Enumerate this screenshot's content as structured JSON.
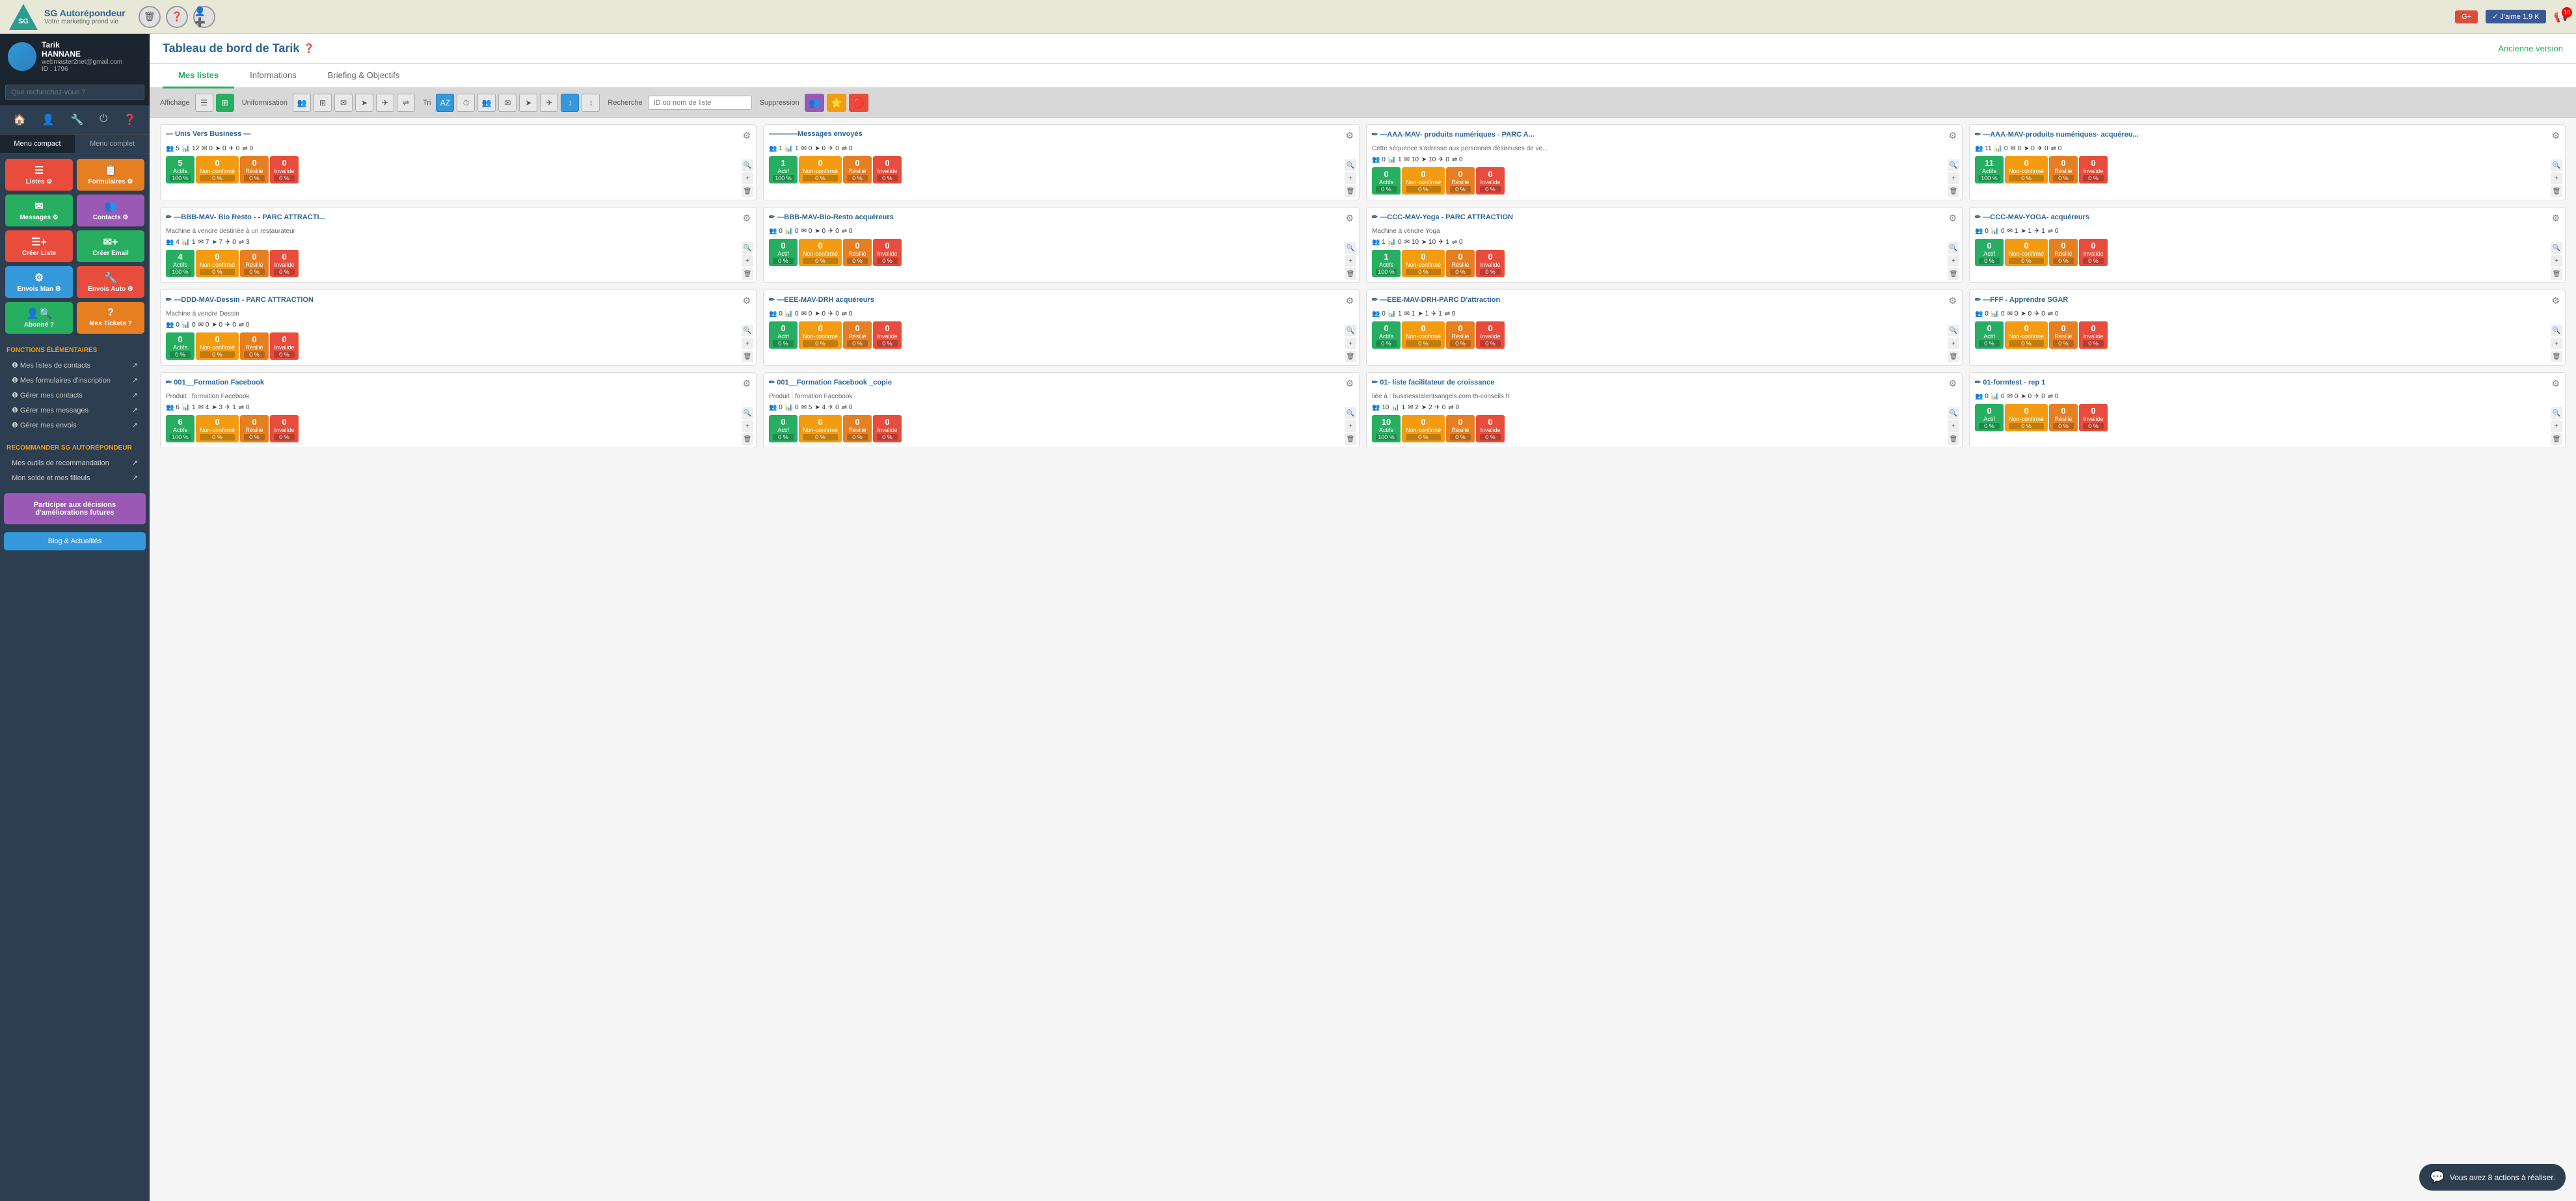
{
  "app": {
    "name": "SG Autorépondeur",
    "tagline": "Votre marketing prend vie",
    "gplus": "G+",
    "jaime": "✓ J'aime 1.9 K",
    "notif_count": "10"
  },
  "header_icons": {
    "delete": "🗑",
    "help": "❓",
    "user_circle": "👤",
    "add_user": "➕"
  },
  "user": {
    "name": "Tarik",
    "lastname": "HANNANE",
    "email": "webmaster2net@gmail.com",
    "id": "ID : 1796"
  },
  "search": {
    "placeholder": "Que recherchez-vous ?"
  },
  "menu": {
    "compact": "Menu compact",
    "complet": "Menu complet"
  },
  "quick_actions": [
    {
      "label": "Listes",
      "icon": "☰",
      "color": "#e74c3c"
    },
    {
      "label": "Formulaires",
      "icon": "📋",
      "color": "#e67e22"
    },
    {
      "label": "Messages",
      "icon": "✉",
      "color": "#27ae60"
    },
    {
      "label": "Contacts",
      "icon": "👥",
      "color": "#9b59b6"
    },
    {
      "label": "Créer Liste",
      "icon": "☰+",
      "color": "#e74c3c"
    },
    {
      "label": "Créer Email",
      "icon": "✉+",
      "color": "#27ae60"
    },
    {
      "label": "Envois Man",
      "icon": "⚙",
      "color": "#3498db"
    },
    {
      "label": "Envois Auto",
      "icon": "🔧",
      "color": "#e74c3c"
    },
    {
      "label": "Abonné ?",
      "icon": "🔍",
      "color": "#27ae60"
    },
    {
      "label": "Mes Tickets",
      "icon": "?",
      "color": "#e67e22"
    }
  ],
  "fonctions_elementaires": {
    "title": "FONCTIONS ÉLÉMENTAIRES",
    "items": [
      "Mes listes de contacts",
      "Mes formulaires d'inscription",
      "Gérer mes contacts",
      "Gérer mes messages",
      "Gérer mes envois"
    ]
  },
  "recommander": {
    "title": "RECOMMANDER SG AUTORÉPONDEUR",
    "items": [
      "Mes outils de recommandation",
      "Mon solde et mes filleuls"
    ]
  },
  "promo": "Participer aux décisions d'améliorations futures",
  "blog": "Blog & Actualités",
  "page": {
    "title": "Tableau de bord de Tarik",
    "old_version": "Ancienne version",
    "tabs": [
      {
        "id": "mes-listes",
        "label": "Mes listes",
        "active": true
      },
      {
        "id": "informations",
        "label": "Informations",
        "active": false
      },
      {
        "id": "briefing",
        "label": "Briefing & Objectifs",
        "active": false
      }
    ]
  },
  "toolbar": {
    "affichage": "Affichage",
    "uniformisation": "Uniformisation",
    "tri": "Tri",
    "recherche": "Recherche",
    "suppression": "Suppression",
    "search_placeholder": "ID ou nom de liste"
  },
  "lists": [
    {
      "title": "— Unis Vers Business —",
      "subtitle": "",
      "stats": [
        5,
        12,
        0,
        0,
        0,
        0
      ],
      "badges": [
        {
          "num": "5",
          "label": "Actifs",
          "pct": "100 %",
          "color": "badge-green"
        },
        {
          "num": "0",
          "label": "Non-confirmé",
          "pct": "0 %",
          "color": "badge-yellow"
        },
        {
          "num": "0",
          "label": "Résilié",
          "pct": "0 %",
          "color": "badge-orange"
        },
        {
          "num": "0",
          "label": "Invalide",
          "pct": "0 %",
          "color": "badge-red"
        }
      ]
    },
    {
      "title": "————Messages envoyés",
      "subtitle": "",
      "stats": [
        1,
        1,
        0,
        0,
        0,
        0
      ],
      "badges": [
        {
          "num": "1",
          "label": "Actif",
          "pct": "100 %",
          "color": "badge-green"
        },
        {
          "num": "0",
          "label": "Non-confirmé",
          "pct": "0 %",
          "color": "badge-yellow"
        },
        {
          "num": "0",
          "label": "Résilié",
          "pct": "0 %",
          "color": "badge-orange"
        },
        {
          "num": "0",
          "label": "Invalide",
          "pct": "0 %",
          "color": "badge-red"
        }
      ]
    },
    {
      "title": "✏ —AAA-MAV- produits numériques - PARC A...",
      "subtitle": "Cette séquence s'adresse aux personnes désireuses de ve...",
      "stats": [
        0,
        1,
        10,
        10,
        0,
        0
      ],
      "badges": [
        {
          "num": "0",
          "label": "Actifs",
          "pct": "0 %",
          "color": "badge-green"
        },
        {
          "num": "0",
          "label": "Non-confirmé",
          "pct": "0 %",
          "color": "badge-yellow"
        },
        {
          "num": "0",
          "label": "Résilié",
          "pct": "0 %",
          "color": "badge-orange"
        },
        {
          "num": "0",
          "label": "Invalide",
          "pct": "0 %",
          "color": "badge-red"
        }
      ]
    },
    {
      "title": "✏ —AAA-MAV-produits numériques- acquéreu...",
      "subtitle": "",
      "stats": [
        11,
        0,
        0,
        0,
        0,
        0
      ],
      "badges": [
        {
          "num": "11",
          "label": "Actifs",
          "pct": "100 %",
          "color": "badge-green"
        },
        {
          "num": "0",
          "label": "Non-confirmé",
          "pct": "0 %",
          "color": "badge-yellow"
        },
        {
          "num": "0",
          "label": "Résilié",
          "pct": "0 %",
          "color": "badge-orange"
        },
        {
          "num": "0",
          "label": "Invalide",
          "pct": "0 %",
          "color": "badge-red"
        }
      ]
    },
    {
      "title": "✏ —BBB-MAV- Bio Resto - - PARC ATTRACTI...",
      "subtitle": "Machine à vendre destinée à un restaurateur",
      "stats": [
        4,
        1,
        7,
        7,
        0,
        3
      ],
      "badges": [
        {
          "num": "4",
          "label": "Actifs",
          "pct": "100 %",
          "color": "badge-green"
        },
        {
          "num": "0",
          "label": "Non-confirmé",
          "pct": "0 %",
          "color": "badge-yellow"
        },
        {
          "num": "0",
          "label": "Résilié",
          "pct": "0 %",
          "color": "badge-orange"
        },
        {
          "num": "0",
          "label": "Invalide",
          "pct": "0 %",
          "color": "badge-red"
        }
      ]
    },
    {
      "title": "✏ —BBB-MAV-Bio-Resto acquéreurs",
      "subtitle": "",
      "stats": [
        0,
        0,
        0,
        0,
        0,
        0
      ],
      "badges": [
        {
          "num": "0",
          "label": "Actif",
          "pct": "0 %",
          "color": "badge-green"
        },
        {
          "num": "0",
          "label": "Non-confirmé",
          "pct": "0 %",
          "color": "badge-yellow"
        },
        {
          "num": "0",
          "label": "Résilié",
          "pct": "0 %",
          "color": "badge-orange"
        },
        {
          "num": "0",
          "label": "Invalide",
          "pct": "0 %",
          "color": "badge-red"
        }
      ]
    },
    {
      "title": "✏ —CCC-MAV-Yoga - PARC ATTRACTION",
      "subtitle": "Machine à vendre Yoga",
      "stats": [
        1,
        0,
        10,
        10,
        1,
        0
      ],
      "badges": [
        {
          "num": "1",
          "label": "Actifs",
          "pct": "100 %",
          "color": "badge-green"
        },
        {
          "num": "0",
          "label": "Non-confirmé",
          "pct": "0 %",
          "color": "badge-yellow"
        },
        {
          "num": "0",
          "label": "Résilié",
          "pct": "0 %",
          "color": "badge-orange"
        },
        {
          "num": "0",
          "label": "Invalide",
          "pct": "0 %",
          "color": "badge-red"
        }
      ]
    },
    {
      "title": "✏ —CCC-MAV-YOGA- acquéreurs",
      "subtitle": "",
      "stats": [
        0,
        0,
        1,
        1,
        1,
        0
      ],
      "badges": [
        {
          "num": "0",
          "label": "Actif",
          "pct": "0 %",
          "color": "badge-green"
        },
        {
          "num": "0",
          "label": "Non-confirmé",
          "pct": "0 %",
          "color": "badge-yellow"
        },
        {
          "num": "0",
          "label": "Résilié",
          "pct": "0 %",
          "color": "badge-orange"
        },
        {
          "num": "0",
          "label": "Invalide",
          "pct": "0 %",
          "color": "badge-red"
        }
      ]
    },
    {
      "title": "✏ —DDD-MAV-Dessin - PARC ATTRACTION",
      "subtitle": "Machine à vendre Dessin",
      "stats": [
        0,
        0,
        0,
        0,
        0,
        0
      ],
      "badges": [
        {
          "num": "0",
          "label": "Actifs",
          "pct": "0 %",
          "color": "badge-green"
        },
        {
          "num": "0",
          "label": "Non-confirmé",
          "pct": "0 %",
          "color": "badge-yellow"
        },
        {
          "num": "0",
          "label": "Résilié",
          "pct": "0 %",
          "color": "badge-orange"
        },
        {
          "num": "0",
          "label": "Invalide",
          "pct": "0 %",
          "color": "badge-red"
        }
      ]
    },
    {
      "title": "✏ —EEE-MAV-DRH acquéreurs",
      "subtitle": "",
      "stats": [
        0,
        0,
        0,
        0,
        0,
        0
      ],
      "badges": [
        {
          "num": "0",
          "label": "Actif",
          "pct": "0 %",
          "color": "badge-green"
        },
        {
          "num": "0",
          "label": "Non-confirmé",
          "pct": "0 %",
          "color": "badge-yellow"
        },
        {
          "num": "0",
          "label": "Résilié",
          "pct": "0 %",
          "color": "badge-orange"
        },
        {
          "num": "0",
          "label": "Invalide",
          "pct": "0 %",
          "color": "badge-red"
        }
      ]
    },
    {
      "title": "✏ —EEE-MAV-DRH-PARC D'attraction",
      "subtitle": "",
      "stats": [
        0,
        1,
        1,
        1,
        1,
        0
      ],
      "badges": [
        {
          "num": "0",
          "label": "Actifs",
          "pct": "0 %",
          "color": "badge-green"
        },
        {
          "num": "0",
          "label": "Non-confirmé",
          "pct": "0 %",
          "color": "badge-yellow"
        },
        {
          "num": "0",
          "label": "Résilié",
          "pct": "0 %",
          "color": "badge-orange"
        },
        {
          "num": "0",
          "label": "Invalide",
          "pct": "0 %",
          "color": "badge-red"
        }
      ]
    },
    {
      "title": "✏ —FFF - Apprendre SGAR",
      "subtitle": "",
      "stats": [
        0,
        0,
        0,
        0,
        0,
        0
      ],
      "badges": [
        {
          "num": "0",
          "label": "Actif",
          "pct": "0 %",
          "color": "badge-green"
        },
        {
          "num": "0",
          "label": "Non-confirmé",
          "pct": "0 %",
          "color": "badge-yellow"
        },
        {
          "num": "0",
          "label": "Résilié",
          "pct": "0 %",
          "color": "badge-orange"
        },
        {
          "num": "0",
          "label": "Invalide",
          "pct": "0 %",
          "color": "badge-red"
        }
      ]
    },
    {
      "title": "✏ 001__Formation Facebook",
      "subtitle": "Produit : formation Facebook",
      "stats": [
        6,
        1,
        4,
        3,
        1,
        0
      ],
      "badges": [
        {
          "num": "6",
          "label": "Actifs",
          "pct": "100 %",
          "color": "badge-green"
        },
        {
          "num": "0",
          "label": "Non-confirmé",
          "pct": "0 %",
          "color": "badge-yellow"
        },
        {
          "num": "0",
          "label": "Résilié",
          "pct": "0 %",
          "color": "badge-orange"
        },
        {
          "num": "0",
          "label": "Invalide",
          "pct": "0 %",
          "color": "badge-red"
        }
      ]
    },
    {
      "title": "✏ 001__Formation Facebook _copie",
      "subtitle": "Produit : formation Facebook",
      "stats": [
        0,
        0,
        5,
        4,
        0,
        0
      ],
      "badges": [
        {
          "num": "0",
          "label": "Actif",
          "pct": "0 %",
          "color": "badge-green"
        },
        {
          "num": "0",
          "label": "Non-confirmé",
          "pct": "0 %",
          "color": "badge-yellow"
        },
        {
          "num": "0",
          "label": "Résilié",
          "pct": "0 %",
          "color": "badge-orange"
        },
        {
          "num": "0",
          "label": "Invalide",
          "pct": "0 %",
          "color": "badge-red"
        }
      ]
    },
    {
      "title": "✏ 01- liste facilitateur de croissance",
      "subtitle": "liée à : businesstalentsangels.com th-conseils.fr",
      "stats": [
        10,
        1,
        2,
        2,
        0,
        0
      ],
      "badges": [
        {
          "num": "10",
          "label": "Actifs",
          "pct": "100 %",
          "color": "badge-green"
        },
        {
          "num": "0",
          "label": "Non-confirmé",
          "pct": "0 %",
          "color": "badge-yellow"
        },
        {
          "num": "0",
          "label": "Résilié",
          "pct": "0 %",
          "color": "badge-orange"
        },
        {
          "num": "0",
          "label": "Invalide",
          "pct": "0 %",
          "color": "badge-red"
        }
      ]
    },
    {
      "title": "✏ 01-formtest - rep 1",
      "subtitle": "",
      "stats": [
        0,
        0,
        0,
        0,
        0,
        0
      ],
      "badges": [
        {
          "num": "0",
          "label": "Actif",
          "pct": "0 %",
          "color": "badge-green"
        },
        {
          "num": "0",
          "label": "Non-confirmé",
          "pct": "0 %",
          "color": "badge-yellow"
        },
        {
          "num": "0",
          "label": "Résilié",
          "pct": "0 %",
          "color": "badge-orange"
        },
        {
          "num": "0",
          "label": "Invalide",
          "pct": "0 %",
          "color": "badge-red"
        }
      ]
    }
  ],
  "chat": "Vous avez 8 actions à réaliser.",
  "icons": {
    "users": "👥",
    "table": "📊",
    "email": "✉",
    "send": "➤",
    "plane": "✈",
    "shuffle": "⇌",
    "sort": "↕",
    "clock": "⏱",
    "settings": "⚙",
    "search_mag": "🔍",
    "plus": "+",
    "trash": "🗑",
    "edit": "✏"
  }
}
